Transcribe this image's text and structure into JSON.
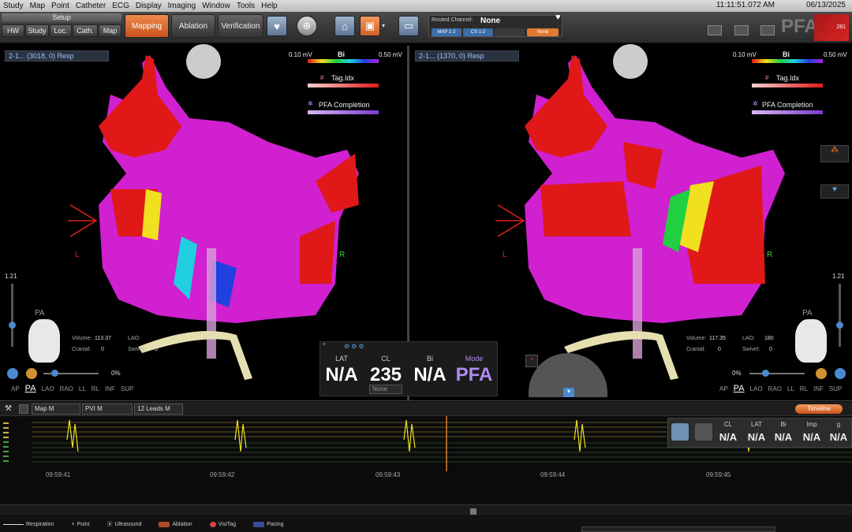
{
  "menu": {
    "items": [
      "Study",
      "Map",
      "Point",
      "Catheter",
      "ECG",
      "Display",
      "Imaging",
      "Window",
      "Tools",
      "Help"
    ],
    "clock": "11:11:51.072 AM",
    "date": "06/13/2025"
  },
  "toolbar": {
    "setup_label": "Setup",
    "setup_buttons": [
      "HW",
      "Study",
      "Loc.",
      "Cath.",
      "Map"
    ],
    "mapping": "Mapping",
    "ablation": "Ablation",
    "verification": "Verification",
    "routed_channel_label": "Routed Channel:",
    "routed_channel_value": "None",
    "routed_chips": [
      "MAP 1-2",
      "CS 1-2",
      "",
      "None"
    ],
    "brand": "PFA",
    "brand_badge": "281"
  },
  "left_view": {
    "title": "2-1... (3018, 0) Resp",
    "bi_min": "0.10 mV",
    "bi_label": "Bi",
    "bi_max": "0.50 mV",
    "tag_label": "Tag.Idx",
    "pfa_label": "PFA Completion",
    "L": "L",
    "R": "R",
    "zoom_value": "1.21",
    "orient_view": "PA",
    "volume_label": "Volume:",
    "volume_value": "113.37",
    "lao_label": "LAO:",
    "lao_value": "",
    "cranial_label": "Cranial:",
    "cranial_value": "0",
    "swivel_label": "Swivel:",
    "swivel_value": "0",
    "percent": "0%",
    "orient_buttons": [
      "AP",
      "PA",
      "LAO",
      "RAO",
      "LL",
      "RL",
      "INF",
      "SUP"
    ]
  },
  "right_view": {
    "title": "2-1... (1370, 0) Resp",
    "bi_min": "0.10 mV",
    "bi_label": "Bi",
    "bi_max": "0.50 mV",
    "tag_label": "Tag.Idx",
    "pfa_label": "PFA Completion",
    "L": "L",
    "R": "R",
    "zoom_value": "1.21",
    "orient_view": "PA",
    "volume_label": "Volume:",
    "volume_value": "117.35",
    "lao_label": "LAO:",
    "lao_value": "180",
    "cranial_label": "Cranial:",
    "cranial_value": "0",
    "swivel_label": "Swivel:",
    "swivel_value": "0",
    "percent": "0%",
    "orient_buttons": [
      "AP",
      "PA",
      "LAO",
      "RAO",
      "LL",
      "RL",
      "INF",
      "SUP"
    ]
  },
  "measurements": {
    "lat_label": "LAT",
    "lat_value": "N/A",
    "cl_label": "CL",
    "cl_value": "235",
    "bi_label": "Bi",
    "bi_value": "N/A",
    "mode_label": "Mode",
    "mode_value": "PFA",
    "dropdown": "None"
  },
  "timeline": {
    "dropdowns": [
      "Map M",
      "PVI M",
      "12 Leads M"
    ],
    "button": "Timeline",
    "times": [
      "09:59:41",
      "09:59:42",
      "09:59:43",
      "09:59:44",
      "09:59:45"
    ],
    "panel": {
      "headers": [
        "CL",
        "LAT",
        "Bi",
        "Imp",
        "g"
      ],
      "values": [
        "N/A",
        "N/A",
        "N/A",
        "N/A",
        "N/A"
      ]
    }
  },
  "legend": {
    "items": [
      "Respiration",
      "Point",
      "Ultrasound",
      "Ablation",
      "VisiTag",
      "Pacing"
    ],
    "colors": [
      "#dddddd",
      "#cccccc",
      "#cccccc",
      "#b04a2a",
      "#d84444",
      "#3a4a9a"
    ]
  },
  "colors": {
    "accent": "#e0702f",
    "mode_purple": "#b08cf0",
    "map_magenta": "#d020d0",
    "map_red": "#e01818"
  }
}
